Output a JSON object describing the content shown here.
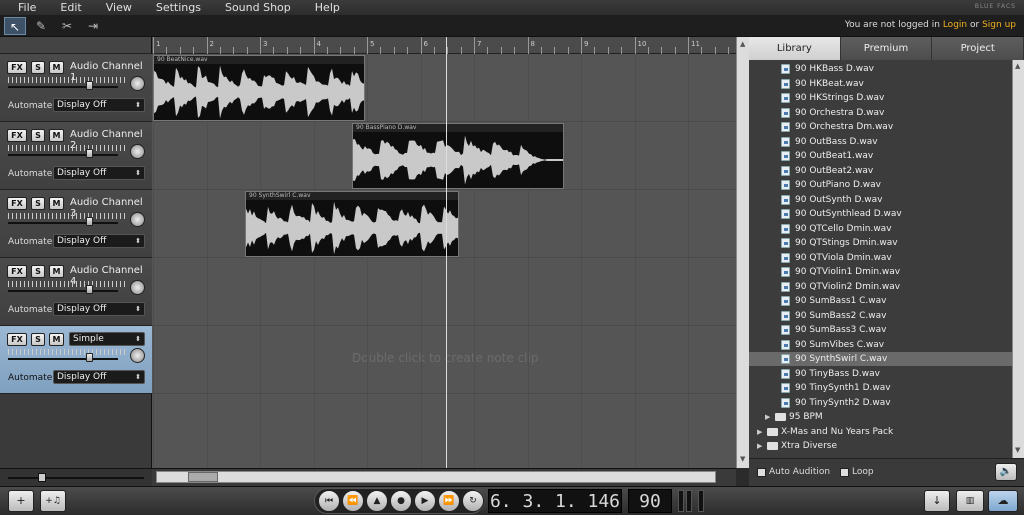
{
  "menu": [
    "File",
    "Edit",
    "View",
    "Settings",
    "Sound Shop",
    "Help"
  ],
  "brand": "BLUE FACS",
  "login": {
    "text": "You are not logged in",
    "login": "Login",
    "or": "or",
    "signup": "Sign up"
  },
  "tools": [
    "pointer",
    "pencil",
    "scissors",
    "trim"
  ],
  "ruler_marks": [
    "1",
    "2",
    "3",
    "4",
    "5",
    "6",
    "7",
    "8",
    "9",
    "10",
    "11"
  ],
  "tracks": [
    {
      "name": "Audio Channel 1",
      "automate": "Display Off",
      "fx": "FX",
      "s": "S",
      "m": "M"
    },
    {
      "name": "Audio Channel 2",
      "automate": "Display Off",
      "fx": "FX",
      "s": "S",
      "m": "M"
    },
    {
      "name": "Audio Channel 3",
      "automate": "Display Off",
      "fx": "FX",
      "s": "S",
      "m": "M"
    },
    {
      "name": "Audio Channel 4",
      "automate": "Display Off",
      "fx": "FX",
      "s": "S",
      "m": "M"
    },
    {
      "name": "",
      "instrument": "Simple",
      "automate": "Display Off",
      "fx": "FX",
      "s": "S",
      "m": "M"
    }
  ],
  "automate_label": "Automate:",
  "clips": [
    {
      "title": "90 BeatNice.wav"
    },
    {
      "title": "90 BassPiano D.wav"
    },
    {
      "title": "90 SynthSwirl C.wav"
    }
  ],
  "hint": "Double click to create note clip",
  "transport": {
    "position": "6. 3. 1. 146",
    "tempo": "90"
  },
  "library": {
    "tabs": [
      "Library",
      "Premium",
      "Project"
    ],
    "files": [
      "90 HKBass D.wav",
      "90 HKBeat.wav",
      "90 HKStrings D.wav",
      "90 Orchestra D.wav",
      "90 Orchestra Dm.wav",
      "90 OutBass D.wav",
      "90 OutBeat1.wav",
      "90 OutBeat2.wav",
      "90 OutPiano D.wav",
      "90 OutSynth D.wav",
      "90 OutSynthlead D.wav",
      "90 QTCello Dmin.wav",
      "90 QTStings Dmin.wav",
      "90 QTViola Dmin.wav",
      "90 QTViolin1 Dmin.wav",
      "90 QTViolin2 Dmin.wav",
      "90 SumBass1 C.wav",
      "90 SumBass2 C.wav",
      "90 SumBass3 C.wav",
      "90 SumVibes C.wav",
      "90 SynthSwirl C.wav",
      "90 TinyBass D.wav",
      "90 TinySynth1 D.wav",
      "90 TinySynth2 D.wav"
    ],
    "selected": "90 SynthSwirl C.wav",
    "folders": [
      "95 BPM",
      "X-Mas and Nu Years Pack",
      "Xtra Diverse"
    ],
    "auto_audition": "Auto Audition",
    "loop": "Loop"
  }
}
